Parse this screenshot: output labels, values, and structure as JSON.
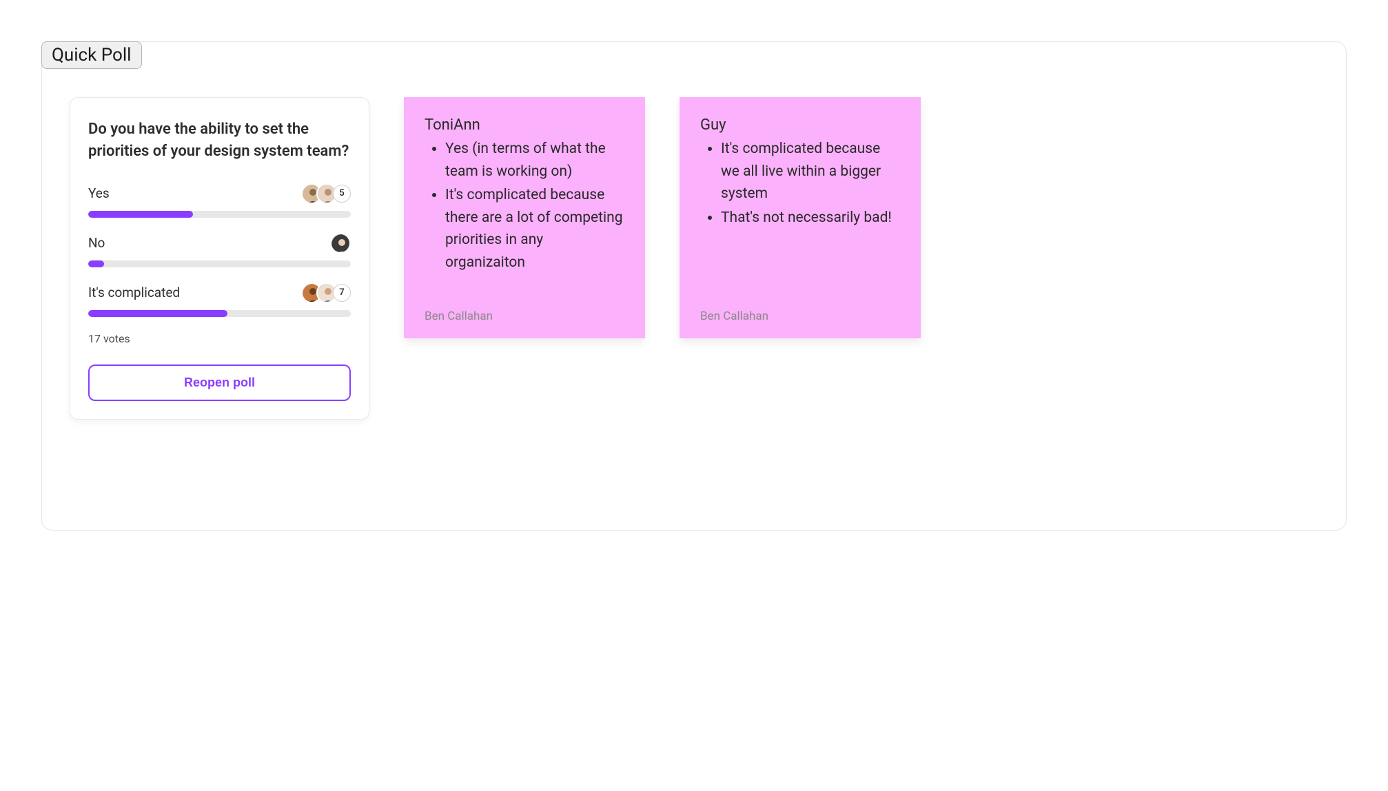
{
  "canvas_label": "Quick Poll",
  "poll": {
    "question": "Do you have the ability to set the priorities of your design system team?",
    "options": [
      {
        "label": "Yes",
        "count": 5,
        "percent": 40,
        "avatars": 2
      },
      {
        "label": "No",
        "count": null,
        "percent": 6,
        "avatars": 1
      },
      {
        "label": "It's complicated",
        "count": 7,
        "percent": 53,
        "avatars": 2
      }
    ],
    "total_text": "17 votes",
    "reopen_label": "Reopen poll"
  },
  "notes": [
    {
      "title": "ToniAnn",
      "bullets": [
        "Yes (in terms of what the team is working on)",
        "It's complicated because there are a lot of competing priorities in any organizaiton"
      ],
      "author": "Ben Callahan"
    },
    {
      "title": "Guy",
      "bullets": [
        "It's complicated because we all live within a bigger system",
        "That's not necessarily bad!"
      ],
      "author": "Ben Callahan"
    }
  ]
}
